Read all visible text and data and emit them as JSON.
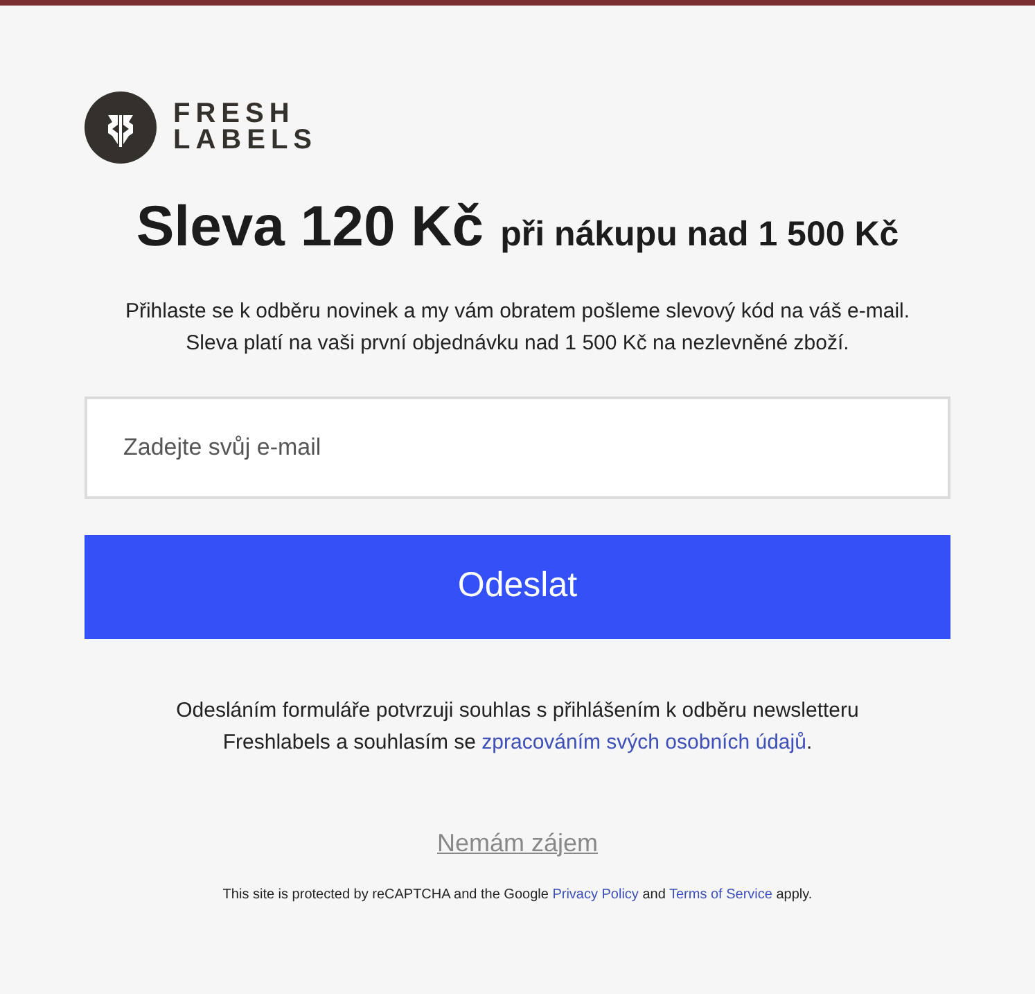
{
  "logo": {
    "lines": [
      "FRESH",
      "LABELS"
    ]
  },
  "heading": {
    "main": "Sleva 120 Kč",
    "sub": "při nákupu nad 1 500 Kč"
  },
  "intro": [
    "Přihlaste se k odběru novinek a my vám obratem pošleme slevový kód na váš e-mail.",
    "Sleva platí na vaši první objednávku nad 1 500 Kč na nezlevněné zboží."
  ],
  "email_field": {
    "placeholder": "Zadejte svůj e-mail"
  },
  "submit_button": {
    "label": "Odeslat"
  },
  "consent": [
    {
      "kind": "text",
      "text": "Odesláním formuláře potvrzuji souhlas s přihlášením k odběru newsletteru Freshlabels a souhlasím se "
    },
    {
      "kind": "link",
      "text": "zpracováním svých osobních údajů"
    },
    {
      "kind": "text",
      "text": "."
    }
  ],
  "decline_link": {
    "label": "Nemám zájem"
  },
  "recaptcha": [
    {
      "kind": "text",
      "text": "This site is protected by reCAPTCHA and the Google "
    },
    {
      "kind": "link",
      "text": "Privacy Policy"
    },
    {
      "kind": "text",
      "text": " and "
    },
    {
      "kind": "link",
      "text": "Terms of Service"
    },
    {
      "kind": "text",
      "text": " apply."
    }
  ]
}
